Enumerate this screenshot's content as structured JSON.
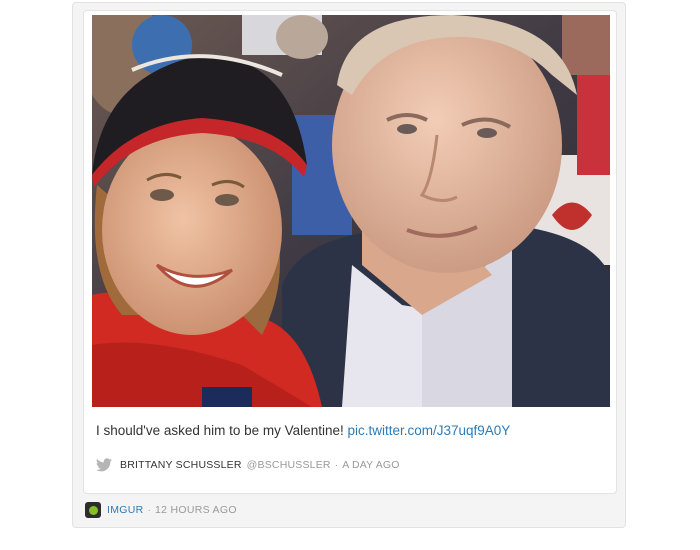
{
  "tweet": {
    "text": "I should've asked him to be my Valentine!",
    "link": "pic.twitter.com/J37uqf9A0Y",
    "author_name": "BRITTANY SCHUSSLER",
    "handle": "@BSCHUSSLER",
    "separator": "·",
    "time": "A DAY AGO",
    "bird_icon": "twitter-bird-icon"
  },
  "source": {
    "name": "IMGUR",
    "separator": "·",
    "time": "12 HOURS AGO",
    "icon": "imgur-icon",
    "icon_color": "#85bf25"
  },
  "colors": {
    "link": "#2b7bb9",
    "muted": "#999999",
    "text": "#333333"
  }
}
